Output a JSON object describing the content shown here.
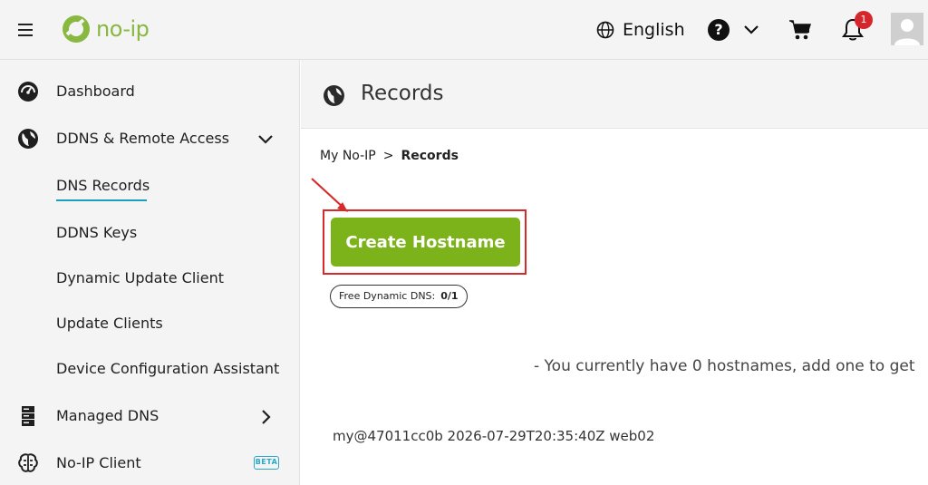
{
  "header": {
    "logo_text": "no-ip",
    "language": "English",
    "help_label": "?",
    "notification_count": "1"
  },
  "sidebar": {
    "items": [
      {
        "label": "Dashboard"
      },
      {
        "label": "DDNS & Remote Access"
      },
      {
        "label": "DNS Records"
      },
      {
        "label": "DDNS Keys"
      },
      {
        "label": "Dynamic Update Client"
      },
      {
        "label": "Update Clients"
      },
      {
        "label": "Device Configuration Assistant"
      },
      {
        "label": "Managed DNS"
      },
      {
        "label": "No-IP Client"
      }
    ],
    "beta_label": "BETA"
  },
  "main": {
    "title": "Records",
    "breadcrumb": {
      "root": "My No-IP",
      "separator": ">",
      "current": "Records"
    },
    "create_button": "Create Hostname",
    "quota_label": "Free Dynamic DNS:",
    "quota_value": "0/1",
    "empty_message": "- You currently have 0 hostnames, add one to get",
    "build_info": "my@47011cc0b 2026-07-29T20:35:40Z web02"
  },
  "colors": {
    "brand_green": "#7db31a",
    "active_accent": "#1a9fbf",
    "annotation_red": "#d72b2b",
    "badge_red": "#d7262b"
  }
}
